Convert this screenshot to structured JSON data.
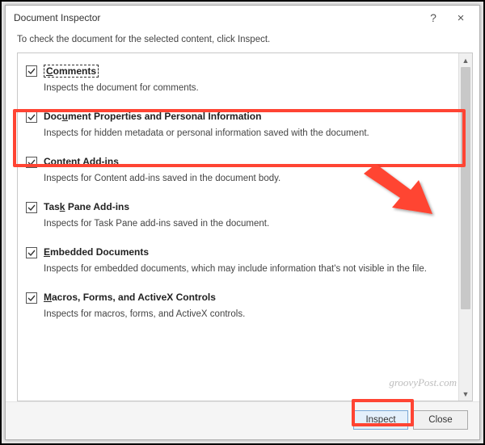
{
  "dialog": {
    "title": "Document Inspector",
    "help_tooltip": "?",
    "close_tooltip": "×",
    "instruction": "To check the document for the selected content, click Inspect."
  },
  "items": [
    {
      "label_pre": "C",
      "label_rest": "omments",
      "desc": "Inspects the document for comments.",
      "checked": true,
      "focused": true
    },
    {
      "label_pre": "",
      "label_rest": "Document Properties and Personal Information",
      "desc": "Inspects for hidden metadata or personal information saved with the document.",
      "checked": true,
      "underline_char": "U"
    },
    {
      "label_pre": "",
      "label_rest": "Content Add-ins",
      "desc": "Inspects for Content add-ins saved in the document body.",
      "checked": true
    },
    {
      "label_pre": "Task Pane Add-ins",
      "label_rest": "",
      "desc": "Inspects for Task Pane add-ins saved in the document.",
      "checked": true,
      "underline_char": "k"
    },
    {
      "label_pre": "",
      "label_rest": "Embedded Documents",
      "desc": "Inspects for embedded documents, which may include information that's not visible in the file.",
      "checked": true,
      "underline_char": "E"
    },
    {
      "label_pre": "",
      "label_rest": "Macros, Forms, and ActiveX Controls",
      "desc": "Inspects for macros, forms, and ActiveX controls.",
      "checked": true,
      "underline_char": "M"
    }
  ],
  "buttons": {
    "inspect": "Inspect",
    "inspect_ul": "I",
    "close": "Close"
  },
  "watermark": "groovyPost.com"
}
